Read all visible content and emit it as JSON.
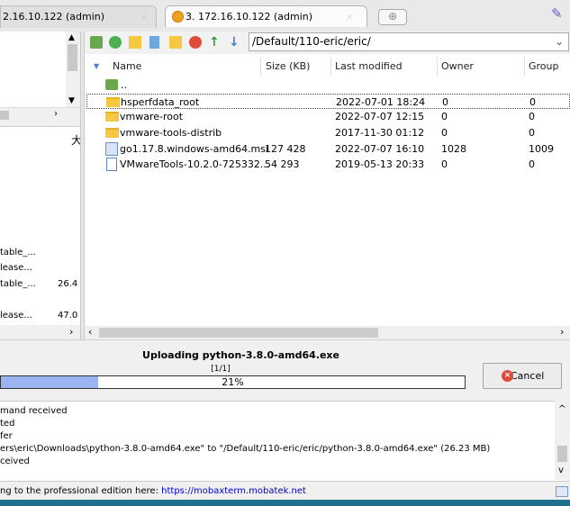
{
  "tabs": [
    {
      "label": "2.16.10.122 (admin)",
      "close": "×"
    },
    {
      "label": "3. 172.16.10.122 (admin)",
      "close": "×"
    }
  ],
  "new_tab_icon": "plus-icon",
  "path": "/Default/110-eric/eric/",
  "columns": {
    "name": "Name",
    "size": "Size (KB)",
    "modified": "Last modified",
    "owner": "Owner",
    "group": "Group"
  },
  "parent_dir": "..",
  "files": [
    {
      "name": "hsperfdata_root",
      "size": "",
      "modified": "2022-07-01 18:24",
      "owner": "0",
      "group": "0",
      "type": "folder"
    },
    {
      "name": "vmware-root",
      "size": "",
      "modified": "2022-07-07 12:15",
      "owner": "0",
      "group": "0",
      "type": "folder"
    },
    {
      "name": "vmware-tools-distrib",
      "size": "",
      "modified": "2017-11-30 01:12",
      "owner": "0",
      "group": "0",
      "type": "folder"
    },
    {
      "name": "go1.17.8.windows-amd64.msi",
      "size": "127 428",
      "modified": "2022-07-07 16:10",
      "owner": "1028",
      "group": "1009",
      "type": "msi"
    },
    {
      "name": "VMwareTools-10.2.0-725332...",
      "size": "54 293",
      "modified": "2019-05-13 20:33",
      "owner": "0",
      "group": "0",
      "type": "file"
    }
  ],
  "left_panel": {
    "header_char": "大",
    "rows": [
      {
        "name": "table_...",
        "size": ""
      },
      {
        "name": "lease...",
        "size": ""
      },
      {
        "name": "table_...",
        "size": "26.4"
      },
      {
        "name": "lease...",
        "size": "47.0"
      }
    ]
  },
  "upload": {
    "title": "Uploading python-3.8.0-amd64.exe",
    "count": "[1/1]",
    "percent_label": "21%",
    "progress": 0.21,
    "cancel_label": "Cancel"
  },
  "log": [
    "mand received",
    "ted",
    "fer",
    "ers\\eric\\Downloads\\python-3.8.0-amd64.exe\" to \"/Default/110-eric/eric/python-3.8.0-amd64.exe\" (26.23 MB)",
    "ceived"
  ],
  "status": {
    "text": "ng to the professional edition here:",
    "link": "https://mobaxterm.mobatek.net"
  },
  "colors": {
    "accent": "#99b4f0",
    "folder": "#f5c843",
    "cancel": "#e04a3a",
    "link": "#0000cc"
  }
}
